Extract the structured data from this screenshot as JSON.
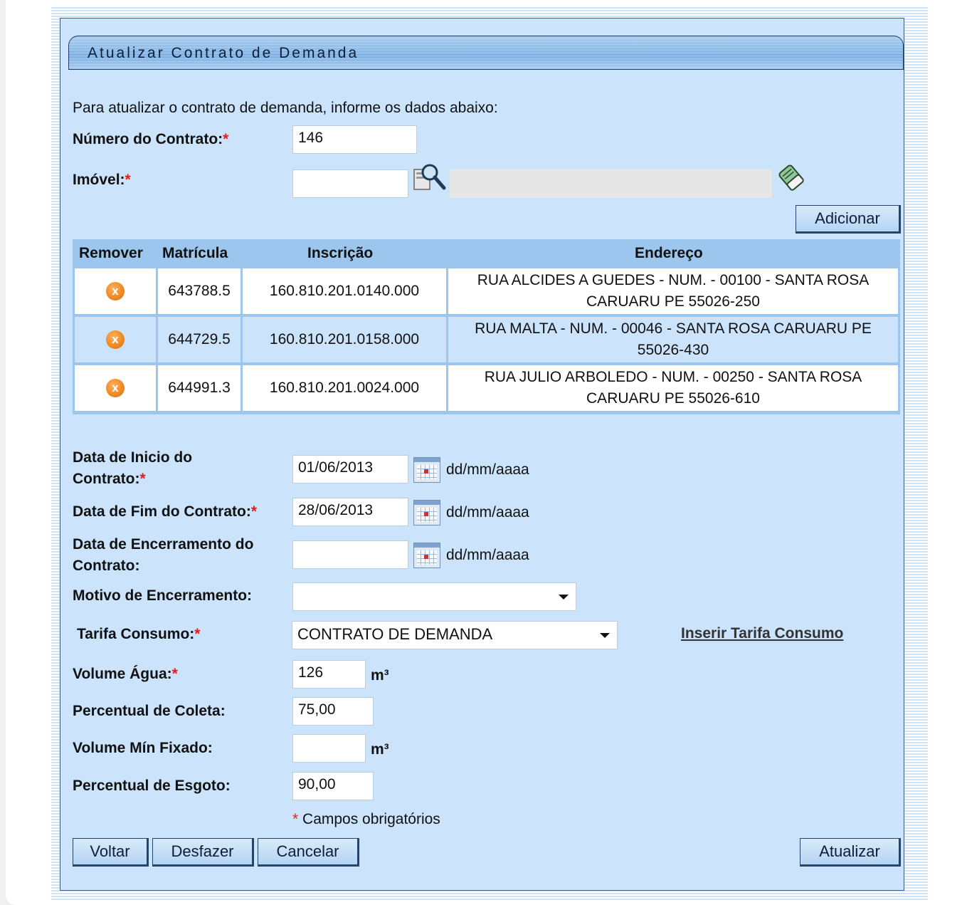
{
  "title": "Atualizar Contrato de Demanda",
  "intro": "Para atualizar o contrato de demanda, informe os dados abaixo:",
  "required_mark": "*",
  "fields": {
    "numero_contrato": {
      "label": "Número do Contrato:",
      "value": "146"
    },
    "imovel": {
      "label": "Imóvel:",
      "value": "",
      "description": ""
    },
    "data_inicio": {
      "label_line1": "Data de Inicio do",
      "label_line2": "Contrato:",
      "value": "01/06/2013",
      "hint": "dd/mm/aaaa"
    },
    "data_fim": {
      "label": "Data de Fim do Contrato:",
      "value": "28/06/2013",
      "hint": "dd/mm/aaaa"
    },
    "data_encerramento": {
      "label_line1": "Data de Encerramento do",
      "label_line2": "Contrato:",
      "value": "",
      "hint": "dd/mm/aaaa"
    },
    "motivo_encerramento": {
      "label": "Motivo de Encerramento:",
      "value": ""
    },
    "tarifa_consumo": {
      "label": "Tarifa Consumo:",
      "value": "CONTRATO DE DEMANDA",
      "link": "Inserir Tarifa Consumo"
    },
    "volume_agua": {
      "label": "Volume Água:",
      "value": "126",
      "unit": "m³"
    },
    "percentual_coleta": {
      "label": "Percentual de Coleta:",
      "value": "75,00"
    },
    "volume_min": {
      "label": "Volume Mín Fixado:",
      "value": "",
      "unit": "m³"
    },
    "percentual_esgoto": {
      "label": "Percentual de Esgoto:",
      "value": "90,00"
    }
  },
  "buttons": {
    "adicionar": "Adicionar",
    "voltar": "Voltar",
    "desfazer": "Desfazer",
    "cancelar": "Cancelar",
    "atualizar": "Atualizar"
  },
  "required_note": "Campos obrigatórios",
  "table": {
    "headers": [
      "Remover",
      "Matrícula",
      "Inscrição",
      "Endereço"
    ],
    "rows": [
      {
        "matricula": "643788.5",
        "inscricao": "160.810.201.0140.000",
        "endereco_l1": "RUA ALCIDES A GUEDES - NUM. - 00100 - SANTA ROSA",
        "endereco_l2": "CARUARU PE 55026-250"
      },
      {
        "matricula": "644729.5",
        "inscricao": "160.810.201.0158.000",
        "endereco_l1": "RUA MALTA - NUM. - 00046 - SANTA ROSA CARUARU PE",
        "endereco_l2": "55026-430"
      },
      {
        "matricula": "644991.3",
        "inscricao": "160.810.201.0024.000",
        "endereco_l1": "RUA JULIO ARBOLEDO - NUM. - 00250 - SANTA ROSA",
        "endereco_l2": "CARUARU PE 55026-610"
      }
    ]
  },
  "icons": {
    "search": "search-icon",
    "eraser": "eraser-icon",
    "remove": "remove-icon",
    "calendar": "calendar-icon"
  }
}
